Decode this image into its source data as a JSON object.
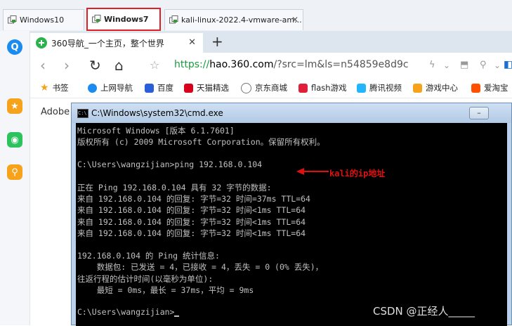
{
  "vm_tabs": [
    {
      "label": "Windows10"
    },
    {
      "label": "Windows7"
    },
    {
      "label": "kali-linux-2022.4-vmware-am..."
    }
  ],
  "browser": {
    "tab_title": "360导航_一个主页，整个世界",
    "url_scheme": "https://",
    "url_host": "hao.360.com",
    "url_path": "/?src=lm&ls=n54859e8d9c",
    "bookmarks": [
      "书签",
      "上网导航",
      "百度",
      "天猫精选",
      "京东商城",
      "flash游戏",
      "腾讯视频",
      "游戏中心",
      "爱淘宝"
    ],
    "page_text": "Adobe"
  },
  "cmd": {
    "title": "C:\\Windows\\system32\\cmd.exe",
    "lines": [
      "Microsoft Windows [版本 6.1.7601]",
      "版权所有 (c) 2009 Microsoft Corporation。保留所有权利。",
      "",
      "C:\\Users\\wangzijian>ping 192.168.0.104",
      "",
      "正在 Ping 192.168.0.104 具有 32 字节的数据:",
      "来自 192.168.0.104 的回复: 字节=32 时间=37ms TTL=64",
      "来自 192.168.0.104 的回复: 字节=32 时间<1ms TTL=64",
      "来自 192.168.0.104 的回复: 字节=32 时间<1ms TTL=64",
      "来自 192.168.0.104 的回复: 字节=32 时间<1ms TTL=64",
      "",
      "192.168.0.104 的 Ping 统计信息:",
      "    数据包: 已发送 = 4，已接收 = 4，丢失 = 0 (0% 丢失)，",
      "往返行程的估计时间(以毫秒为单位):",
      "    最短 = 0ms，最长 = 37ms，平均 = 9ms",
      "",
      "C:\\Users\\wangzijian>"
    ]
  },
  "annotation": "kali的ip地址",
  "watermark": "CSDN @正经人_____",
  "colors": {
    "annotation": "#e01010",
    "active_tab_border": "#e21e26",
    "url_scheme": "#1a9b3c"
  }
}
